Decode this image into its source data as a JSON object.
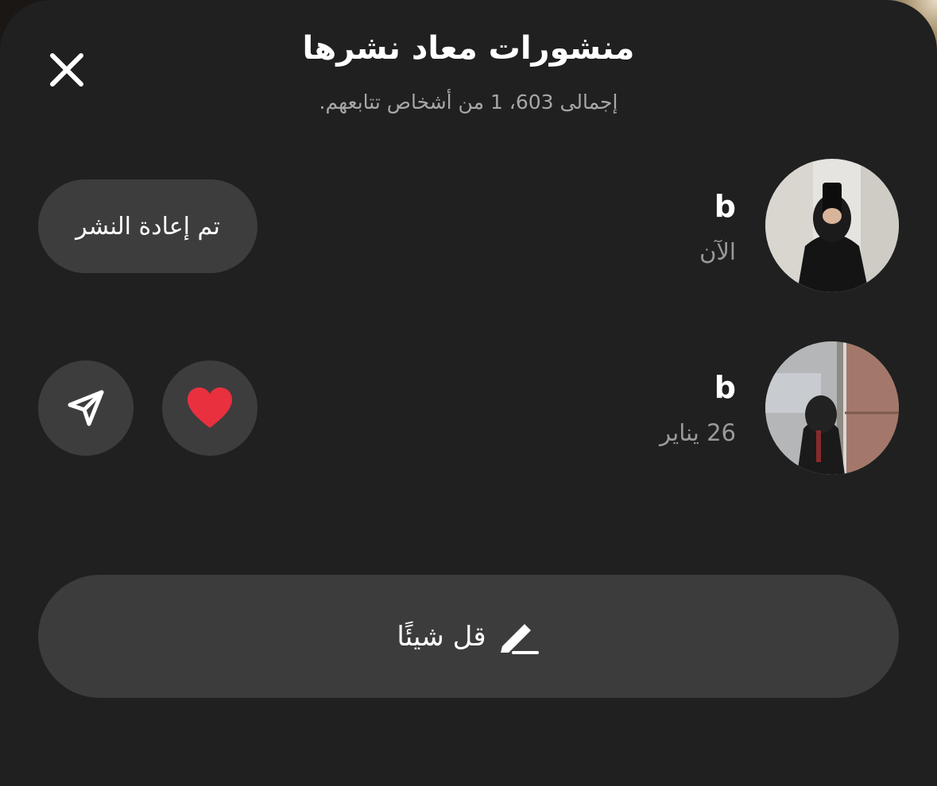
{
  "header": {
    "title": "منشورات معاد نشرها",
    "subtitle": "إجمالى 603، 1 من أشخاص تتابعهم."
  },
  "reposts": [
    {
      "username": "b",
      "time": "الآن",
      "action_label": "تم إعادة النشر"
    },
    {
      "username": "b",
      "time": "26 يناير"
    }
  ],
  "composer": {
    "label": "قل شيئًا"
  },
  "icons": {
    "close": "close-icon",
    "like": "heart-icon",
    "share": "send-icon",
    "compose": "pencil-icon"
  },
  "colors": {
    "sheet": "#202020",
    "control": "#3d3d3d",
    "secondary_text": "#9a9a9a",
    "heart": "#e8303f"
  }
}
